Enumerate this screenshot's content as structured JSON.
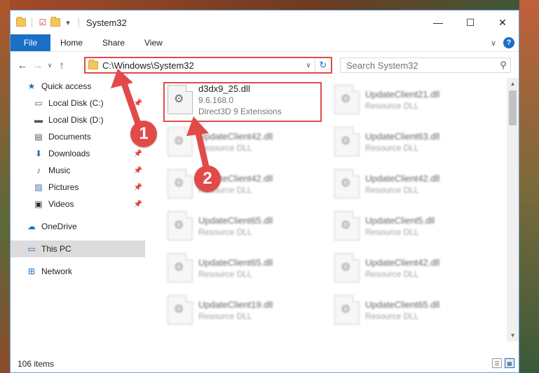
{
  "window": {
    "title": "System32",
    "controls": {
      "minimize": "—",
      "maximize": "☐",
      "close": "✕"
    }
  },
  "ribbon": {
    "tabs": [
      "File",
      "Home",
      "Share",
      "View"
    ],
    "help_label": "?"
  },
  "address": {
    "path": "C:\\Windows\\System32",
    "search_placeholder": "Search System32"
  },
  "nav": {
    "quick_access": "Quick access",
    "items": [
      {
        "label": "Local Disk (C:)",
        "icon": "drive-icon",
        "pinned": true
      },
      {
        "label": "Local Disk (D:)",
        "icon": "drive-icon",
        "pinned": false
      },
      {
        "label": "Documents",
        "icon": "documents-icon",
        "pinned": true
      },
      {
        "label": "Downloads",
        "icon": "downloads-icon",
        "pinned": true
      },
      {
        "label": "Music",
        "icon": "music-icon",
        "pinned": true
      },
      {
        "label": "Pictures",
        "icon": "pictures-icon",
        "pinned": true
      },
      {
        "label": "Videos",
        "icon": "videos-icon",
        "pinned": true
      }
    ],
    "onedrive": "OneDrive",
    "this_pc": "This PC",
    "network": "Network"
  },
  "files": [
    {
      "name": "d3dx9_25.dll",
      "version": "9.6.168.0",
      "desc": "Direct3D 9 Extensions"
    },
    {
      "name": "UpdateClient21.dll",
      "desc": "Resource DLL"
    },
    {
      "name": "UpdateClient42.dll",
      "desc": "Resource DLL"
    },
    {
      "name": "UpdateClient63.dll",
      "desc": "Resource DLL"
    },
    {
      "name": "UpdateClient42.dll",
      "desc": "Resource DLL"
    },
    {
      "name": "UpdateClient42.dll",
      "desc": "Resource DLL"
    },
    {
      "name": "UpdateClient65.dll",
      "desc": "Resource DLL"
    },
    {
      "name": "UpdateClient5.dll",
      "desc": "Resource DLL"
    },
    {
      "name": "UpdateClient65.dll",
      "desc": "Resource DLL"
    },
    {
      "name": "UpdateClient42.dll",
      "desc": "Resource DLL"
    },
    {
      "name": "UpdateClient19.dll",
      "desc": "Resource DLL"
    },
    {
      "name": "UpdateClient65.dll",
      "desc": "Resource DLL"
    }
  ],
  "status": {
    "count": "106 items"
  },
  "callouts": [
    "1",
    "2"
  ],
  "colors": {
    "accent": "#1a6fc7",
    "highlight": "#e24a4a"
  }
}
